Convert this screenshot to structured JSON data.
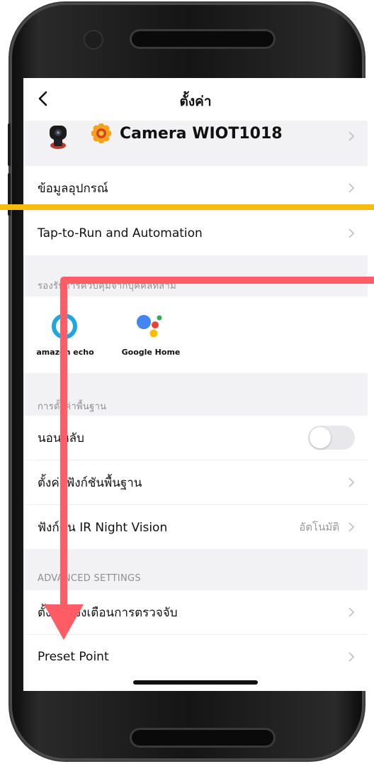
{
  "nav": {
    "title": "ตั้งค่า"
  },
  "device": {
    "name": "Camera WIOT1018"
  },
  "rows": {
    "device_info": "ข้อมูลอุปกรณ์",
    "tap_to_run": "Tap-to-Run and Automation",
    "sleep": "นอนหลับ",
    "basic_functions": "ตั้งค่าฟังก์ชันพื้นฐาน",
    "ir_night_vision": "ฟังก์ชั่น IR Night Vision",
    "ir_night_vision_value": "อัตโนมัติ",
    "detection_alert": "ตั้งค่าแจ้งเตือนการตรวจจับ",
    "preset_point": "Preset Point"
  },
  "sections": {
    "third_party": "รองรับการควบคุมจากบุคคลที่สาม",
    "basic_settings": "การตั้งค่าพื้นฐาน",
    "advanced": "ADVANCED SETTINGS"
  },
  "third_party": [
    {
      "name": "amazon echo",
      "icon": "amazon-echo-icon"
    },
    {
      "name": "Google Home",
      "icon": "google-home-icon"
    }
  ],
  "toggles": {
    "sleep_on": false
  },
  "colors": {
    "arrow": "#ff5c65",
    "highlight_line": "#f5bd0e",
    "alexa_ring": "#1ea7e1",
    "google_blue": "#4285f4",
    "google_red": "#ea4335",
    "google_yellow": "#fbbc05",
    "google_green": "#34a853"
  }
}
